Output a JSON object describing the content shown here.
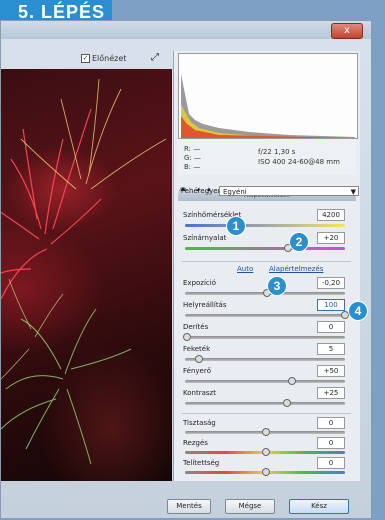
{
  "step_badge": "5. LÉPÉS",
  "window": {
    "close_label": "x"
  },
  "toolbar": {
    "preview_label": "Előnézet",
    "preview_checked": "✓"
  },
  "readout": {
    "r": "R: —",
    "g": "G: —",
    "b": "B: —",
    "aperture": "f/22  1,30 s",
    "iso": "ISO 400   24-60@48 mm"
  },
  "panel": {
    "section_title": "Alapbeállítások",
    "white_balance_label": "Fehéregyensúly:",
    "white_balance_value": "Egyéni",
    "auto_link": "Auto",
    "default_link": "Alapértelmezés",
    "sliders": [
      {
        "label": "Színhőmérséklet",
        "value": "4200"
      },
      {
        "label": "Színárnyalat",
        "value": "+20"
      },
      {
        "label": "Expozíció",
        "value": "-0,20"
      },
      {
        "label": "Helyreállítás",
        "value": "100"
      },
      {
        "label": "Derítés",
        "value": "0"
      },
      {
        "label": "Feketék",
        "value": "5"
      },
      {
        "label": "Fényerő",
        "value": "+50"
      },
      {
        "label": "Kontraszt",
        "value": "+25"
      },
      {
        "label": "Tisztaság",
        "value": "0"
      },
      {
        "label": "Rezgés",
        "value": "0"
      },
      {
        "label": "Telítettség",
        "value": "0"
      }
    ]
  },
  "callouts": [
    "1",
    "2",
    "3",
    "4"
  ],
  "footer": {
    "save_label": "Mentés",
    "cancel_label": "Mégse",
    "done_label": "Kész"
  }
}
